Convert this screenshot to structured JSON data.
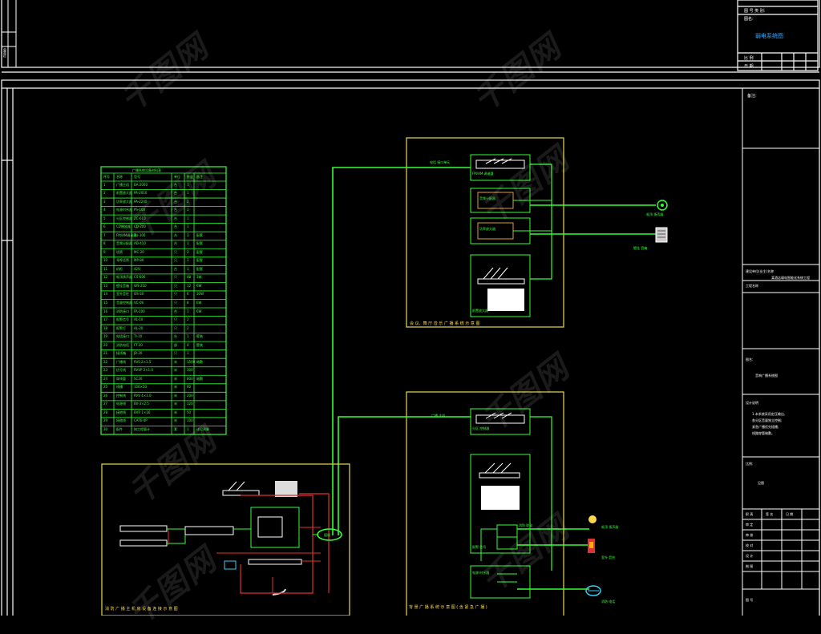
{
  "title_block_top": {
    "field_1": "图 号 类 别:",
    "field_2": "图名:",
    "drawing_name": "弱电系统图",
    "row_labels": [
      "比 例",
      "日 期"
    ]
  },
  "panel_a": {
    "label": "会 议、舞 厅 音 乐 广 播 系 统 示 意 图",
    "device_labels": [
      "电话 接口单元",
      "FM/AM 调谐器",
      "音频分配器",
      "功率放大器",
      "前置放大器"
    ],
    "endpoint_labels": [
      "吸顶 扬声器",
      "壁挂 音箱"
    ]
  },
  "panel_b": {
    "label": "背 景 广 播 系 统 示 意 图 ( 含 紧 急 广 播 )",
    "device_labels": [
      "广播 主机",
      "分区 控制器",
      "消防 联动",
      "报警 信号",
      "电源 时序器"
    ],
    "endpoint_labels": [
      "吸顶 扬声器",
      "室外 音柱",
      "消防 电话"
    ]
  },
  "panel_c": {
    "label": "消 防 广 播 主 机 房 设 备 连 接 示 意 图",
    "junction_label": "接线"
  },
  "legend": {
    "title": "广播系统设备材料表",
    "headers": [
      "序号",
      "名称",
      "型号",
      "单位",
      "数量",
      "备注"
    ],
    "rows": [
      [
        "1",
        "广播主机",
        "BA-2000",
        "台",
        "1",
        ""
      ],
      [
        "2",
        "前置放大器",
        "PA-2010",
        "台",
        "1",
        ""
      ],
      [
        "3",
        "功率放大器",
        "PA-2240",
        "台",
        "2",
        ""
      ],
      [
        "4",
        "电源时序器",
        "PS-100",
        "台",
        "1",
        ""
      ],
      [
        "5",
        "分区控制器",
        "ZC-610",
        "台",
        "1",
        ""
      ],
      [
        "6",
        "CD播放器",
        "CD-200",
        "台",
        "1",
        ""
      ],
      [
        "7",
        "FM/AM调谐器",
        "TU-100",
        "台",
        "1",
        "配套"
      ],
      [
        "8",
        "音频分配器",
        "AD-410",
        "台",
        "1",
        "配套"
      ],
      [
        "9",
        "话筒",
        "MC-20",
        "只",
        "2",
        "配套"
      ],
      [
        "10",
        "寻呼话筒",
        "MP-80",
        "只",
        "1",
        "配套"
      ],
      [
        "11",
        "机柜",
        "42U",
        "台",
        "1",
        "配套"
      ],
      [
        "12",
        "吸顶扬声器",
        "CS-606",
        "只",
        "48",
        "3W"
      ],
      [
        "13",
        "壁挂音箱",
        "WS-210",
        "只",
        "12",
        "6W"
      ],
      [
        "14",
        "室外音柱",
        "OS-30",
        "只",
        "6",
        "30W"
      ],
      [
        "15",
        "音量控制器",
        "VC-06",
        "只",
        "8",
        "6W"
      ],
      [
        "16",
        "消防接口",
        "FA-100",
        "台",
        "1",
        "6W"
      ],
      [
        "17",
        "报警信号",
        "AL-10",
        "只",
        "2",
        ""
      ],
      [
        "18",
        "报警灯",
        "AL-20",
        "只",
        "2",
        ""
      ],
      [
        "19",
        "电话接口",
        "TI-10",
        "台",
        "1",
        "壁装"
      ],
      [
        "20",
        "消防电话",
        "FT-20",
        "部",
        "4",
        "壁装"
      ],
      [
        "21",
        "接线箱",
        "JB-20",
        "只",
        "1",
        ""
      ],
      [
        "22",
        "广播线",
        "RVS 2×1.5",
        "米",
        "1500",
        "暗敷"
      ],
      [
        "23",
        "信号线",
        "RVVP 2×1.0",
        "米",
        "300",
        ""
      ],
      [
        "24",
        "穿线管",
        "SC20",
        "米",
        "800",
        "暗敷"
      ],
      [
        "25",
        "线槽",
        "100×50",
        "米",
        "60",
        ""
      ],
      [
        "26",
        "控制线",
        "RVV 4×1.0",
        "米",
        "200",
        ""
      ],
      [
        "27",
        "电源线",
        "BV-3×2.5",
        "米",
        "120",
        ""
      ],
      [
        "28",
        "接地线",
        "BVR 1×16",
        "米",
        "50",
        ""
      ],
      [
        "29",
        "网络线",
        "CAT6-4P",
        "米",
        "100",
        ""
      ],
      [
        "30",
        "配件",
        "按工程量计",
        "套",
        "1",
        "详见预算"
      ]
    ]
  },
  "right_title_block": {
    "notes": "备注:",
    "client_label": "建设单位(业主)名称",
    "client_value": "某酒店弱电智能化系统工程",
    "project_label": "工程名称",
    "drawing_label": "图名:",
    "drawing_value": "音响广播系统图",
    "desc_label": "设计说明",
    "desc_lines": [
      "1.本系统采用定压输出,",
      "各分区音量独立控制;",
      "紧急广播优先插播;",
      "线路穿管暗敷。"
    ],
    "scale_label": "比例:",
    "scale_value": "见图",
    "sign_headers": [
      "职 责",
      "签 名",
      "日 期"
    ],
    "sign_rows": [
      "审 定",
      "审 核",
      "校 对",
      "设 计",
      "制 图"
    ],
    "footer": "图 号"
  },
  "left_strip_text": "会签栏",
  "watermark_text": "千图网",
  "colors": {
    "background": "#000000",
    "frame": "#ffffff",
    "wire": "#33ff33",
    "panel": "#d8c84a",
    "red": "#e23030",
    "accent": "#2a8bff"
  }
}
